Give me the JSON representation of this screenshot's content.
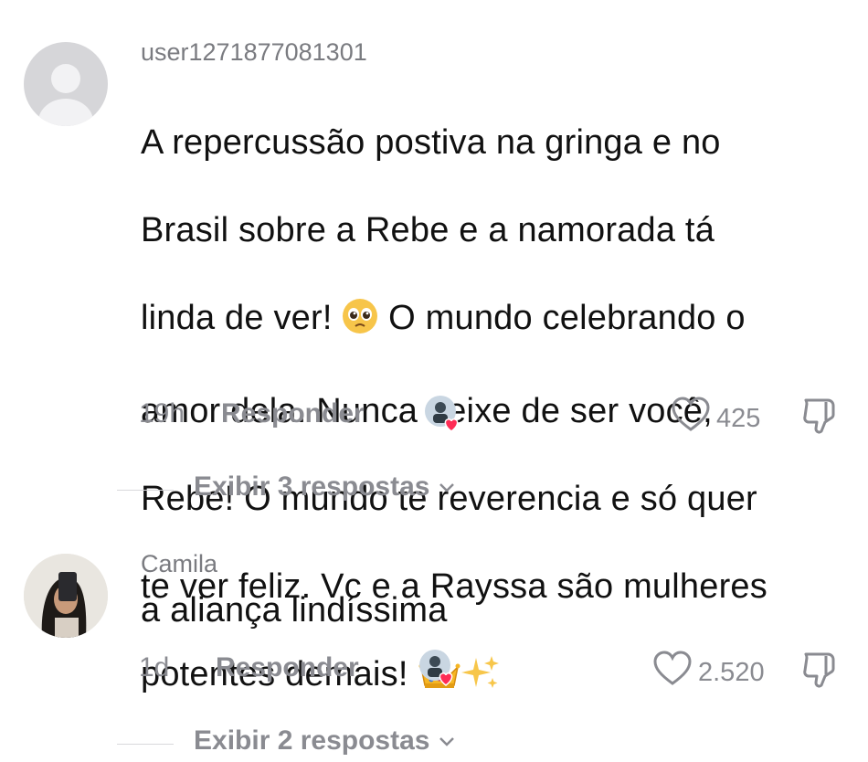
{
  "comments": [
    {
      "username": "user1271877081301",
      "avatar_icon": "default-avatar-icon",
      "text_line1": "A repercussão postiva na gringa e no",
      "text_line2": "Brasil sobre a Rebe e a namorada tá",
      "text_line3a": "linda de ver! ",
      "text_line3b": " O mundo celebrando o",
      "text_line4": "amor dela. Nunca deixe de ser você,",
      "text_line5": "Rebe! O mundo te reverencia e só quer",
      "text_line6": "te ver feliz. Vc e a Rayssa são mulheres",
      "text_line7": "potentes demais! ",
      "time": "19h",
      "reply_label": "Responder",
      "likes": "425",
      "view_replies_label": "Exibir 3 respostas"
    },
    {
      "username": "Camila",
      "avatar_icon": "profile-photo",
      "text": "a aliança lindíssima",
      "time": "1d",
      "reply_label": "Responder",
      "likes": "2.520",
      "view_replies_label": "Exibir 2 respostas"
    }
  ],
  "colors": {
    "accent_like": "#fe2c55",
    "meta_gray": "#8a8b91"
  },
  "icons": [
    "pleading-face-emoji",
    "crown-emoji",
    "sparkles-emoji",
    "heart-outline-icon",
    "dislike-icon",
    "chevron-down-icon",
    "creator-liked-badge"
  ]
}
